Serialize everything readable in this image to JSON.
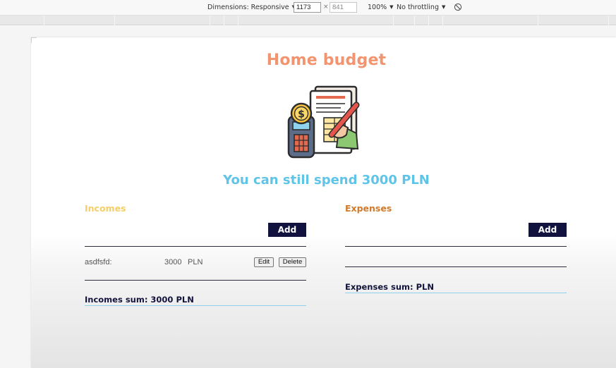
{
  "devtools": {
    "dimensions_label": "Dimensions: Responsive",
    "width_value": "1173",
    "height_value": "841",
    "times_symbol": "×",
    "zoom_label": "100%",
    "throttling_label": "No throttling",
    "caret": "▼"
  },
  "app": {
    "title": "Home budget",
    "remaining_text": "You can still spend 3000 PLN",
    "colors": {
      "title": "#f2946f",
      "remaining": "#5fc4e6",
      "incomes_heading": "#f6cd68",
      "expenses_heading": "#cf7a2c",
      "button_bg": "#12123f"
    },
    "hero_icon": "budget-calculator-document-pen-icon"
  },
  "incomes": {
    "heading": "Incomes",
    "add_label": "Add",
    "items": [
      {
        "name": "asdfsfd:",
        "amount": "3000",
        "currency": "PLN",
        "edit_label": "Edit",
        "delete_label": "Delete"
      }
    ],
    "sum_text": "Incomes sum: 3000 PLN"
  },
  "expenses": {
    "heading": "Expenses",
    "add_label": "Add",
    "items": [],
    "sum_text": "Expenses sum: PLN"
  }
}
